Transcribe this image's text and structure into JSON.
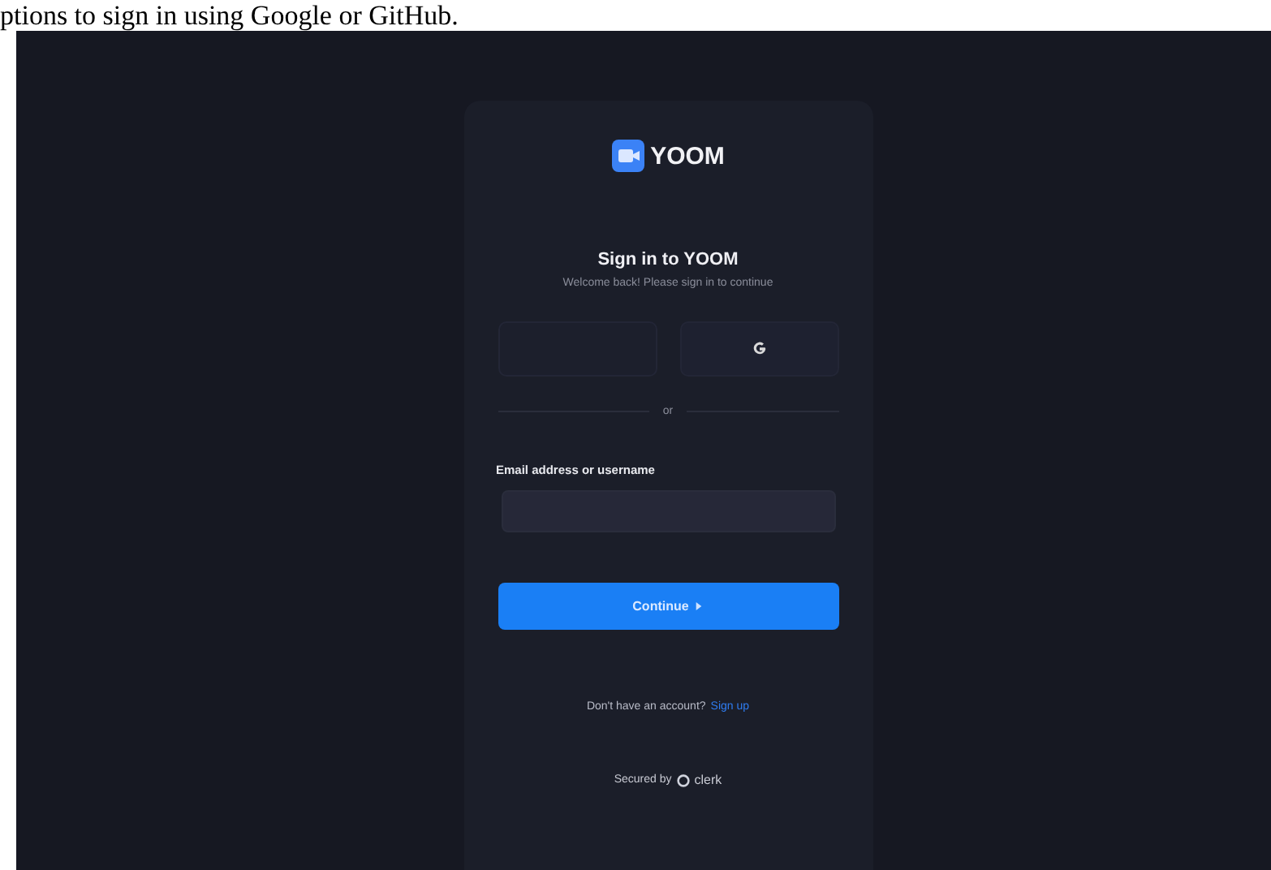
{
  "caption": "ptions to sign in using Google or GitHub.",
  "card": {
    "brand": "YOOM",
    "title": "Sign in to YOOM",
    "subtitle": "Welcome back! Please sign in to continue",
    "social_buttons": [
      {
        "kind": "blank"
      },
      {
        "kind": "google"
      }
    ],
    "divider": "or",
    "email_label": "Email address or username",
    "continue_button": "Continue",
    "signup_prompt": "Don't have an account?",
    "signup_link": "Sign up",
    "secured_by": "Secured by",
    "secured_brand": "clerk"
  }
}
